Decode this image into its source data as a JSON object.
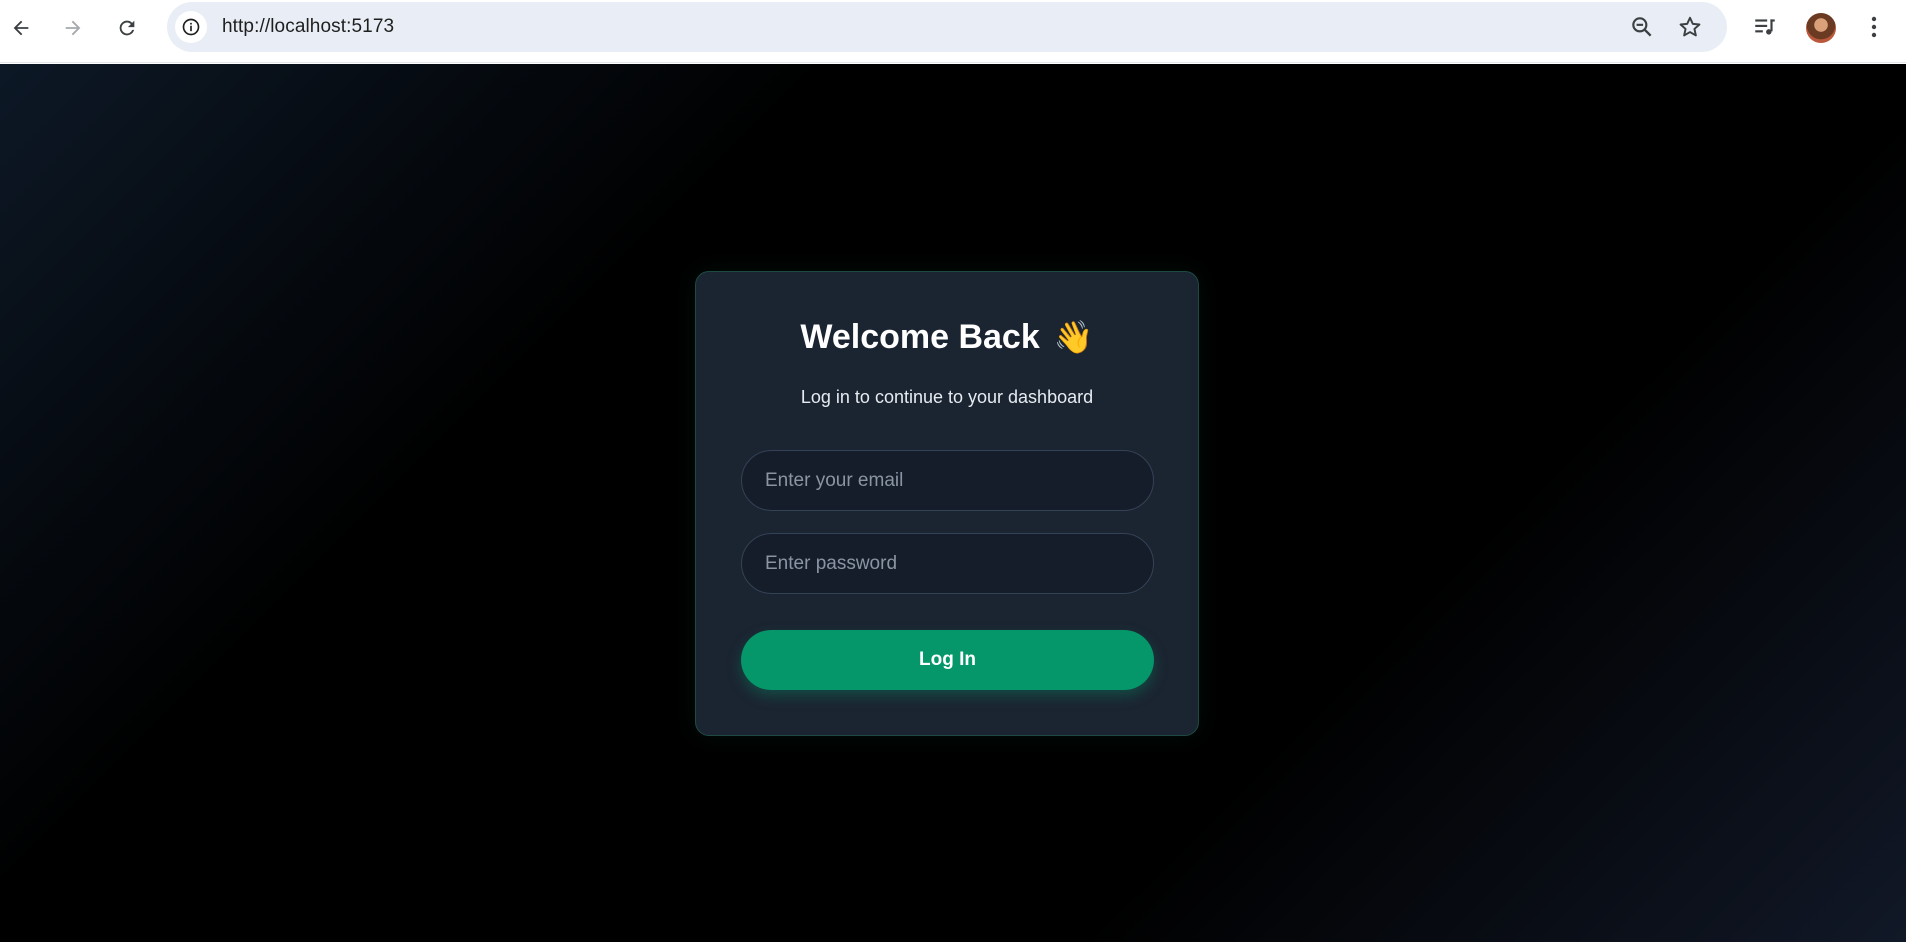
{
  "browser": {
    "url": "http://localhost:5173",
    "icons": {
      "back": "arrow-left-icon",
      "forward": "arrow-right-icon",
      "reload": "reload-icon",
      "site_info": "info-icon",
      "zoom": "zoom-out-icon",
      "bookmark": "star-icon",
      "media": "media-playlist-icon",
      "profile": "avatar",
      "menu": "kebab-menu-icon"
    }
  },
  "login": {
    "title": "Welcome Back",
    "title_emoji": "👋",
    "subtitle": "Log in to continue to your dashboard",
    "email_placeholder": "Enter your email",
    "email_value": "",
    "password_placeholder": "Enter password",
    "password_value": "",
    "submit_label": "Log In"
  },
  "colors": {
    "accent": "#059669",
    "card_background": "#1b2431",
    "page_background": "#000000"
  }
}
